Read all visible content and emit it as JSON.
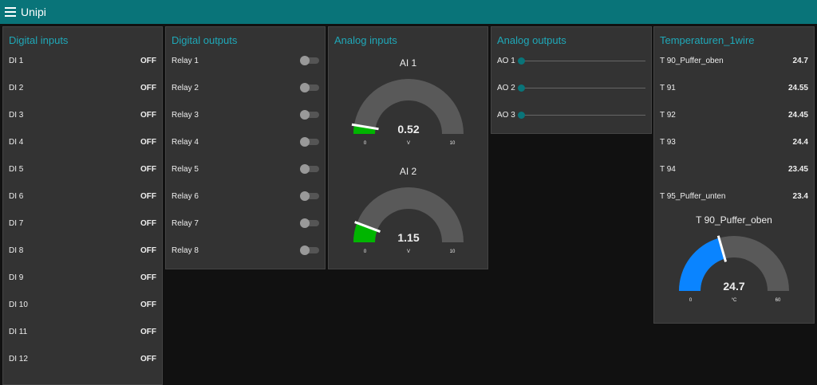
{
  "header": {
    "title": "Unipi"
  },
  "digital_inputs": {
    "title": "Digital inputs",
    "items": [
      {
        "label": "DI 1",
        "value": "OFF"
      },
      {
        "label": "DI 2",
        "value": "OFF"
      },
      {
        "label": "DI 3",
        "value": "OFF"
      },
      {
        "label": "DI 4",
        "value": "OFF"
      },
      {
        "label": "DI 5",
        "value": "OFF"
      },
      {
        "label": "DI 6",
        "value": "OFF"
      },
      {
        "label": "DI 7",
        "value": "OFF"
      },
      {
        "label": "DI 8",
        "value": "OFF"
      },
      {
        "label": "DI 9",
        "value": "OFF"
      },
      {
        "label": "DI 10",
        "value": "OFF"
      },
      {
        "label": "DI 11",
        "value": "OFF"
      },
      {
        "label": "DI 12",
        "value": "OFF"
      }
    ]
  },
  "digital_outputs": {
    "title": "Digital outputs",
    "items": [
      {
        "label": "Relay 1",
        "on": false
      },
      {
        "label": "Relay 2",
        "on": false
      },
      {
        "label": "Relay 3",
        "on": false
      },
      {
        "label": "Relay 4",
        "on": false
      },
      {
        "label": "Relay 5",
        "on": false
      },
      {
        "label": "Relay 6",
        "on": false
      },
      {
        "label": "Relay 7",
        "on": false
      },
      {
        "label": "Relay 8",
        "on": false
      }
    ]
  },
  "analog_inputs": {
    "title": "Analog inputs",
    "gauges": [
      {
        "label": "AI 1",
        "value": "0.52",
        "num": 0.52,
        "unit": "V",
        "min": "0",
        "max": "10",
        "color": "#00b500"
      },
      {
        "label": "AI 2",
        "value": "1.15",
        "num": 1.15,
        "unit": "V",
        "min": "0",
        "max": "10",
        "color": "#00b500"
      }
    ]
  },
  "analog_outputs": {
    "title": "Analog outputs",
    "items": [
      {
        "label": "AO 1",
        "value": 0
      },
      {
        "label": "AO 2",
        "value": 0
      },
      {
        "label": "AO 3",
        "value": 0
      }
    ]
  },
  "temperatures": {
    "title": "Temperaturen_1wire",
    "items": [
      {
        "label": "T 90_Puffer_oben",
        "value": "24.7"
      },
      {
        "label": "T 91",
        "value": "24.55"
      },
      {
        "label": "T 92",
        "value": "24.45"
      },
      {
        "label": "T 93",
        "value": "24.4"
      },
      {
        "label": "T 94",
        "value": "23.45"
      },
      {
        "label": "T 95_Puffer_unten",
        "value": "23.4"
      }
    ],
    "gauge": {
      "label": "T 90_Puffer_oben",
      "value": "24.7",
      "num": 24.7,
      "unit": "°C",
      "min": "0",
      "max": "60",
      "color": "#0a84ff"
    }
  },
  "accent": "#097479"
}
